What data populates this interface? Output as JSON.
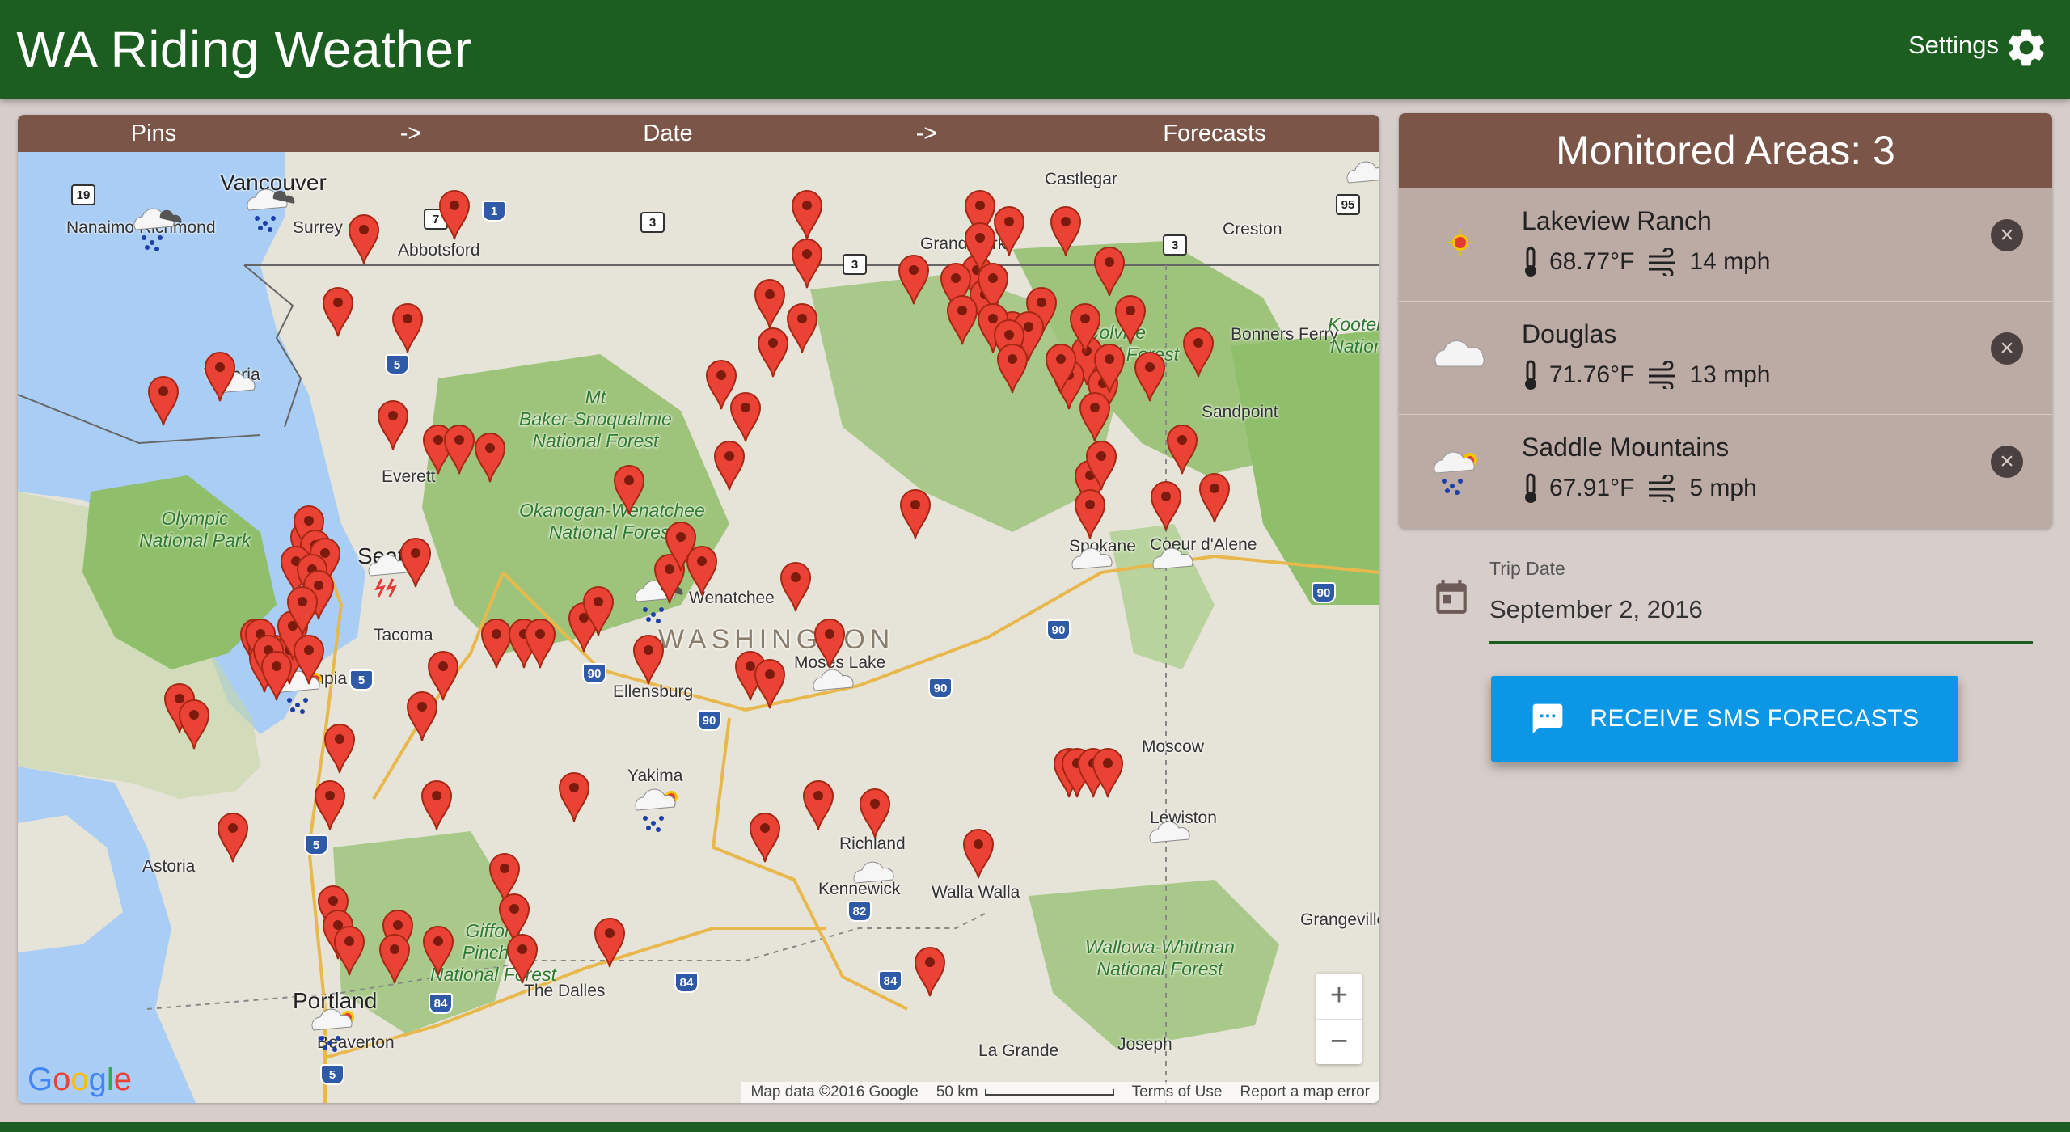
{
  "app": {
    "title": "WA Riding Weather",
    "settings_label": "Settings",
    "colors": {
      "primary": "#1b5e20",
      "accent_brown": "#7a5548",
      "button_blue": "#0c96e6",
      "background": "#d7cecb"
    }
  },
  "steps": [
    "Pins",
    "->",
    "Date",
    "->",
    "Forecasts"
  ],
  "map": {
    "labels": {
      "vancouver": "Vancouver",
      "nanaimo": "Nanaimo",
      "richmond": "Richmond",
      "surrey": "Surrey",
      "abbotsford": "Abbotsford",
      "castlegar": "Castlegar",
      "grand_forks": "Grand Forks",
      "creston": "Creston",
      "bonners_ferry": "Bonners Ferry",
      "sandpoint": "Sandpoint",
      "victoria": "Victoria",
      "everett": "Everett",
      "seattle": "Seattle",
      "tacoma": "Tacoma",
      "olympia": "Olympia",
      "spokane": "Spokane",
      "coeur_dalene": "Coeur d'Alene",
      "wenatchee": "Wenatchee",
      "ellensburg": "Ellensburg",
      "moses_lake": "Moses Lake",
      "yakima": "Yakima",
      "moscow": "Moscow",
      "lewiston": "Lewiston",
      "richland": "Richland",
      "kennewick": "Kennewick",
      "walla_walla": "Walla Walla",
      "astoria": "Astoria",
      "portland": "Portland",
      "beaverton": "Beaverton",
      "the_dalles": "The Dalles",
      "grangeville": "Grangeville",
      "la_grande": "La Grande",
      "joseph": "Joseph",
      "washington": "WASHINGTON"
    },
    "parks": {
      "olympic": "Olympic\nNational Park",
      "baker": "Mt\nBaker-Snoqualmie\nNational Forest",
      "okanogan": "Okanogan-Wenatchee\nNational Forest",
      "colville": "Colville\nNational Forest",
      "kootenai": "Kootenai\nNational",
      "gifford": "Gifford\nPinchot\nNational Forest",
      "wallowa": "Wallowa-Whitman\nNational Forest"
    },
    "shields": {
      "s19": "19",
      "s1": "1",
      "s7": "7",
      "s3a": "3",
      "s3b": "3",
      "s3c": "3",
      "s95": "95",
      "i5a": "5",
      "i5b": "5",
      "i5c": "5",
      "i5d": "5",
      "i90a": "90",
      "i90b": "90",
      "i90c": "90",
      "i90d": "90",
      "i90e": "90",
      "i82": "82",
      "i84a": "84",
      "i84b": "84",
      "i84c": "84"
    },
    "pin_count": 113,
    "google_logo": "Google",
    "footer": {
      "map_data": "Map data ©2016 Google",
      "scale": "50 km",
      "terms": "Terms of Use",
      "report": "Report a map error"
    },
    "zoom_in": "+",
    "zoom_out": "−"
  },
  "monitored": {
    "title": "Monitored Areas: 3",
    "areas": [
      {
        "name": "Lakeview Ranch",
        "temp": "68.77°F",
        "wind": "14 mph",
        "icon": "sun-icon"
      },
      {
        "name": "Douglas",
        "temp": "71.76°F",
        "wind": "13 mph",
        "icon": "cloud-icon"
      },
      {
        "name": "Saddle Mountains",
        "temp": "67.91°F",
        "wind": "5 mph",
        "icon": "rain-sun-icon"
      }
    ],
    "remove_glyph": "×"
  },
  "trip": {
    "label": "Trip Date",
    "value": "September 2, 2016"
  },
  "sms_button": {
    "label": "RECEIVE SMS FORECASTS"
  }
}
